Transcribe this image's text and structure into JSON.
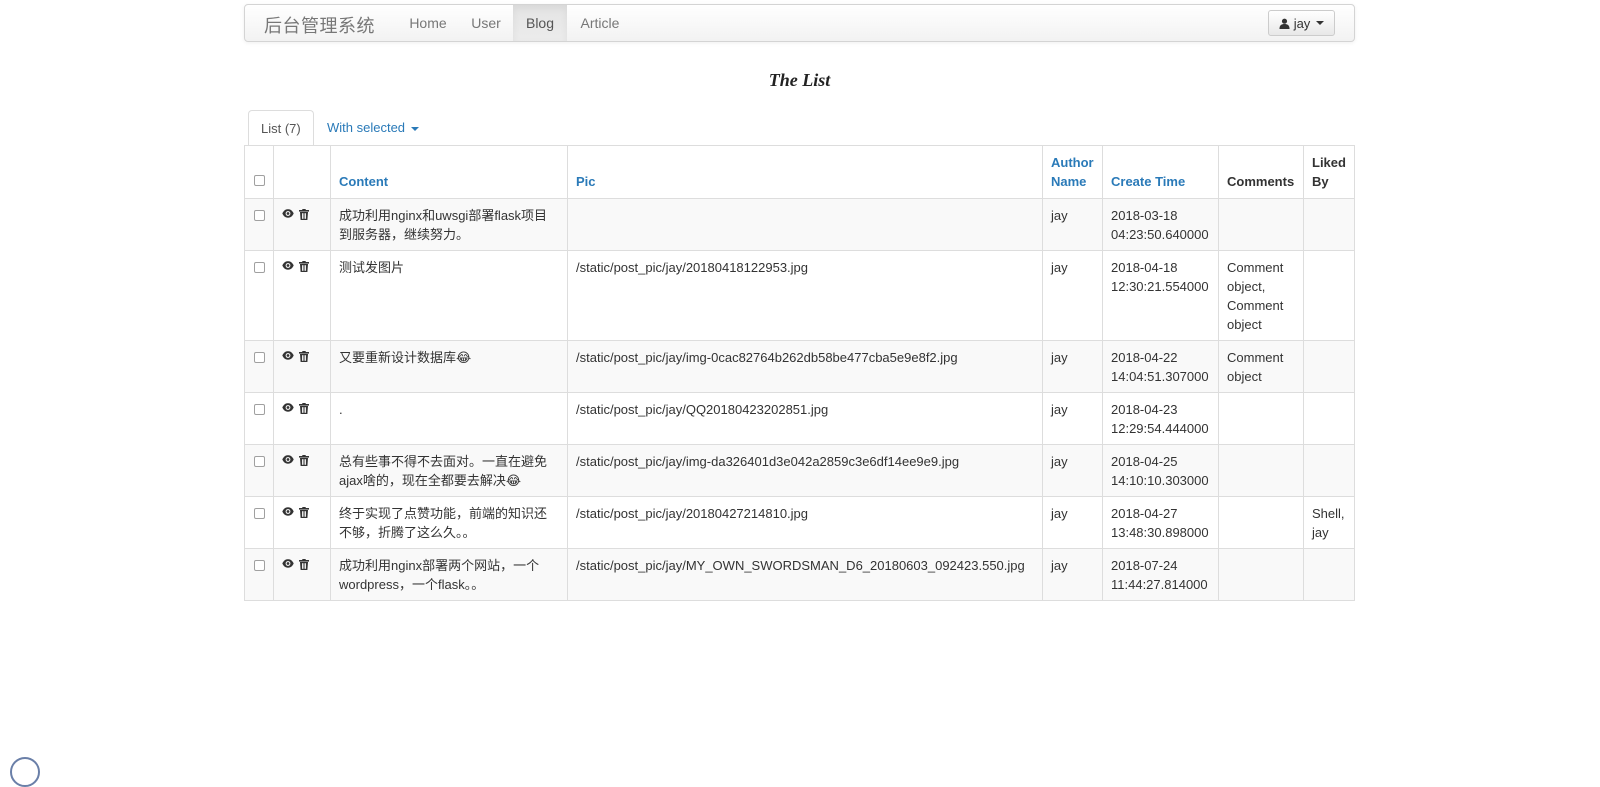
{
  "navbar": {
    "brand": "后台管理系统",
    "items": [
      {
        "label": "Home"
      },
      {
        "label": "User"
      },
      {
        "label": "Blog"
      },
      {
        "label": "Article"
      }
    ],
    "user_label": "jay"
  },
  "page_title": "The List",
  "tabs": {
    "list_label": "List (7)",
    "with_selected_label": "With selected"
  },
  "table": {
    "headers": {
      "content": "Content",
      "pic": "Pic",
      "author_name": "Author Name",
      "create_time": "Create Time",
      "comments": "Comments",
      "liked_by": "Liked By"
    },
    "rows": [
      {
        "content": "成功利用nginx和uwsgi部署flask项目到服务器，继续努力。",
        "pic": "",
        "author": "jay",
        "create_time": "2018-03-18 04:23:50.640000",
        "comments": "",
        "liked_by": ""
      },
      {
        "content": "测试发图片",
        "pic": "/static/post_pic/jay/20180418122953.jpg",
        "author": "jay",
        "create_time": "2018-04-18 12:30:21.554000",
        "comments": "Comment object, Comment object",
        "liked_by": ""
      },
      {
        "content": "又要重新设计数据库😂",
        "pic": "/static/post_pic/jay/img-0cac82764b262db58be477cba5e9e8f2.jpg",
        "author": "jay",
        "create_time": "2018-04-22 14:04:51.307000",
        "comments": "Comment object",
        "liked_by": ""
      },
      {
        "content": ".",
        "pic": "/static/post_pic/jay/QQ20180423202851.jpg",
        "author": "jay",
        "create_time": "2018-04-23 12:29:54.444000",
        "comments": "",
        "liked_by": ""
      },
      {
        "content": "总有些事不得不去面对。一直在避免ajax啥的，现在全都要去解决😂",
        "pic": "/static/post_pic/jay/img-da326401d3e042a2859c3e6df14ee9e9.jpg",
        "author": "jay",
        "create_time": "2018-04-25 14:10:10.303000",
        "comments": "",
        "liked_by": ""
      },
      {
        "content": "终于实现了点赞功能，前端的知识还不够，折腾了这么久。。",
        "pic": "/static/post_pic/jay/20180427214810.jpg",
        "author": "jay",
        "create_time": "2018-04-27 13:48:30.898000",
        "comments": "",
        "liked_by": "Shell, jay"
      },
      {
        "content": "成功利用nginx部署两个网站，一个wordpress，一个flask。。",
        "pic": "/static/post_pic/jay/MY_OWN_SWORDSMAN_D6_20180603_092423.550.jpg",
        "author": "jay",
        "create_time": "2018-07-24 11:44:27.814000",
        "comments": "",
        "liked_by": ""
      }
    ]
  },
  "icons": {
    "user": "user-icon",
    "view": "eye-icon",
    "delete": "trash-icon",
    "caret": "caret-down-icon"
  },
  "colors": {
    "link": "#2a7ab8",
    "stripe": "#f9f9f9",
    "border": "#dddddd"
  }
}
